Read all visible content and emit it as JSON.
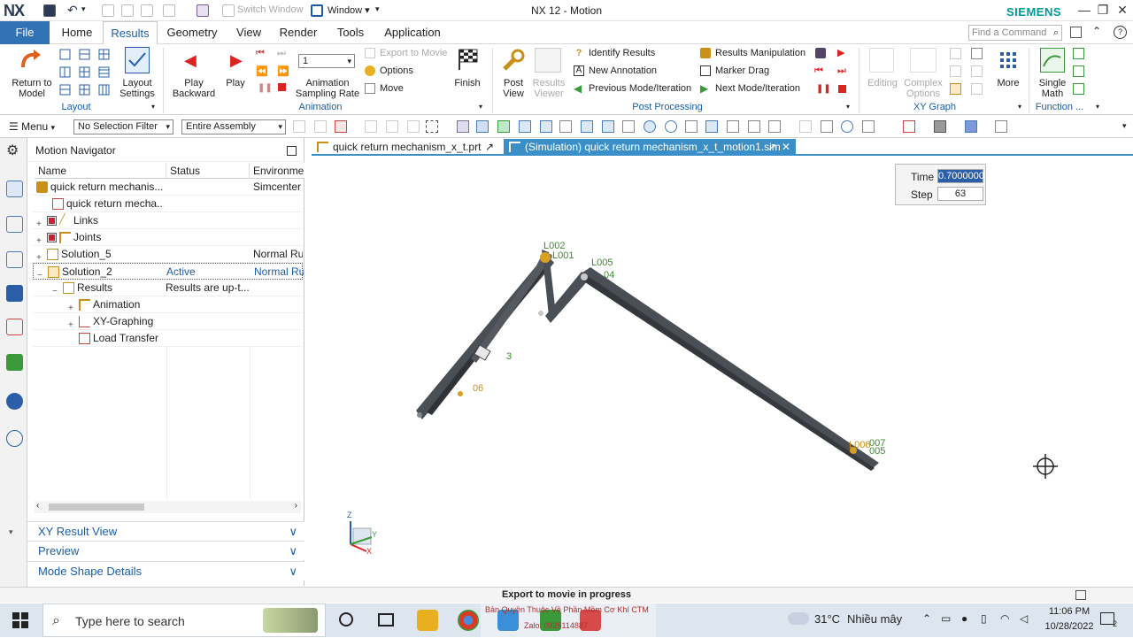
{
  "titlebar": {
    "logo": "NX",
    "window_menu": "Window",
    "switch_window": "Switch Window",
    "title": "NX 12 - Motion",
    "brand": "SIEMENS",
    "minimize": "—",
    "restore": "❐",
    "close": "✕"
  },
  "menu_tabs": [
    "File",
    "Home",
    "Results",
    "Geometry",
    "View",
    "Render",
    "Tools",
    "Application"
  ],
  "menu_search_placeholder": "Find a Command",
  "ribbon": {
    "return_to_model": "Return to Model",
    "layout_settings": "Layout Settings",
    "layout_group": "Layout",
    "play_backward": "Play Backward",
    "play": "Play",
    "sampling_value": "1",
    "animation_sampling_rate": "Animation Sampling Rate",
    "export_to_movie": "Export to Movie",
    "options": "Options",
    "move": "Move",
    "finish": "Finish",
    "animation_group": "Animation",
    "post_view": "Post View",
    "results_viewer": "Results Viewer",
    "identify_results": "Identify Results",
    "new_annotation": "New Annotation",
    "previous_mode": "Previous Mode/Iteration",
    "results_manipulation": "Results Manipulation",
    "marker_drag": "Marker Drag",
    "next_mode": "Next Mode/Iteration",
    "post_processing_group": "Post Processing",
    "editing": "Editing",
    "complex_options": "Complex Options",
    "more": "More",
    "single_math": "Single Math",
    "xy_graph_group": "XY Graph",
    "function_group": "Function ..."
  },
  "toolbar": {
    "menu": "Menu",
    "selection_filter": "No Selection Filter",
    "assembly_scope": "Entire Assembly"
  },
  "navigator": {
    "title": "Motion Navigator",
    "columns": [
      "Name",
      "Status",
      "Environme"
    ],
    "rows": [
      {
        "name": "quick return mechanis...",
        "status": "",
        "env": "Simcenter M"
      },
      {
        "name": "quick return mecha...",
        "status": "",
        "env": ""
      },
      {
        "name": "Links",
        "status": "",
        "env": ""
      },
      {
        "name": "Joints",
        "status": "",
        "env": ""
      },
      {
        "name": "Solution_5",
        "status": "",
        "env": "Normal Ru"
      },
      {
        "name": "Solution_2",
        "status": "Active",
        "env": "Normal Ru"
      },
      {
        "name": "Results",
        "status": "Results are up-t...",
        "env": ""
      },
      {
        "name": "Animation",
        "status": "",
        "env": ""
      },
      {
        "name": "XY-Graphing",
        "status": "",
        "env": ""
      },
      {
        "name": "Load Transfer",
        "status": "",
        "env": ""
      }
    ],
    "sections": [
      "XY Result View",
      "Preview",
      "Mode Shape Details"
    ]
  },
  "doc_tabs": [
    {
      "label": "quick return mechanism_x_t.prt"
    },
    {
      "label": "(Simulation) quick return mechanism_x_t_motion1.sim"
    }
  ],
  "playback": {
    "time_label": "Time",
    "time_value": "0.7000000",
    "step_label": "Step",
    "step_value": "63"
  },
  "markers": {
    "l002": "L002",
    "l001": "L001",
    "l005": "L005",
    "l004": "04",
    "l003": "3",
    "l006": "06",
    "tip1": "L006",
    "tip2": "007",
    "tip3": "005"
  },
  "triad": {
    "z": "Z",
    "y": "Y",
    "x": "X"
  },
  "status_text": "Export to movie in progress",
  "taskbar": {
    "search_placeholder": "Type here to search",
    "watermark_line1": "Bản Quyền Thuộc Về Phần Mềm Cơ Khí CTM",
    "watermark_line2": "Zalo: 0925114887",
    "temperature": "31°C",
    "weather": "Nhiều mây",
    "time": "11:06 PM",
    "date": "10/28/2022",
    "notifications": "2"
  },
  "colors": {
    "accent": "#3a8fc9",
    "file_tab": "#3072b3",
    "brand": "#009999",
    "link_body": "#4a4f55"
  }
}
